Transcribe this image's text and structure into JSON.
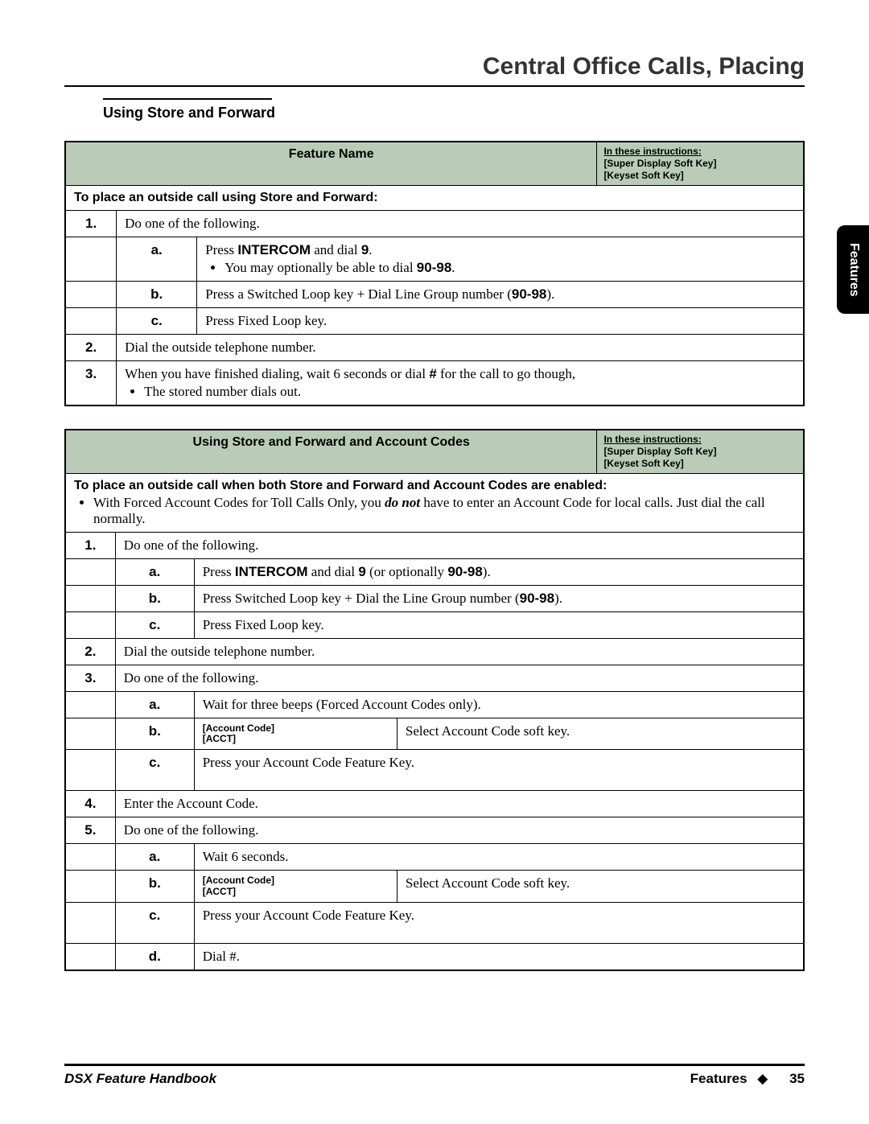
{
  "header": {
    "title": "Central Office Calls, Placing"
  },
  "sideTab": "Features",
  "section": {
    "subtitle": "Using Store and Forward"
  },
  "instructionsBox": {
    "line1": "In these instructions:",
    "line2": "[Super Display Soft Key]",
    "line3": "[Keyset Soft Key]"
  },
  "table1": {
    "title": "Feature Name",
    "sectionHead": "To place an outside call using Store and Forward:",
    "r1_num": "1.",
    "r1_text": "Do one of the following.",
    "r1a_label": "a.",
    "r1a_pre": "Press ",
    "r1a_key": "INTERCOM",
    "r1a_mid": " and dial ",
    "r1a_nine": "9",
    "r1a_dot": ".",
    "r1a_bullet_pre": "You may optionally be able to dial ",
    "r1a_bullet_range": "90-98",
    "r1a_bullet_dot": ".",
    "r1b_label": "b.",
    "r1b_pre": "Press a Switched Loop key + Dial Line Group number (",
    "r1b_range": "90-98",
    "r1b_post": ").",
    "r1c_label": "c.",
    "r1c_text": "Press Fixed Loop key.",
    "r2_num": "2.",
    "r2_text": "Dial the outside telephone number.",
    "r3_num": "3.",
    "r3_pre": "When you have finished dialing, wait 6 seconds or dial ",
    "r3_hash": "#",
    "r3_post": " for the call to go though,",
    "r3_bullet": "The stored number dials out."
  },
  "table2": {
    "title": "Using Store and Forward and Account Codes",
    "sectionHead": "To place an outside call when both Store and Forward and Account Codes are enabled:",
    "section_bullet_pre": "With Forced Account Codes for Toll Calls Only, you ",
    "section_bullet_em": "do not",
    "section_bullet_post": " have to enter an Account Code for local calls. Just dial the call normally.",
    "r1_num": "1.",
    "r1_text": "Do one of the following.",
    "r1a_label": "a.",
    "r1a_pre": "Press ",
    "r1a_key": "INTERCOM",
    "r1a_mid": " and dial ",
    "r1a_nine": "9",
    "r1a_opt": " (or optionally ",
    "r1a_range": "90-98",
    "r1a_end": ").",
    "r1b_label": "b.",
    "r1b_pre": "Press Switched Loop key + Dial the Line Group number (",
    "r1b_range": "90-98",
    "r1b_post": ").",
    "r1c_label": "c.",
    "r1c_text": "Press Fixed Loop key.",
    "r2_num": "2.",
    "r2_text": "Dial the outside telephone number.",
    "r3_num": "3.",
    "r3_text": "Do one of the following.",
    "r3a_label": "a.",
    "r3a_text": "Wait for three beeps (Forced Account Codes only).",
    "r3b_label": "b.",
    "r3b_key1": "[Account Code]",
    "r3b_key2": "[ACCT]",
    "r3b_text": "Select Account Code soft key.",
    "r3c_label": "c.",
    "r3c_text": "Press your Account Code Feature Key.",
    "r4_num": "4.",
    "r4_text": "Enter the Account Code.",
    "r5_num": "5.",
    "r5_text": "Do one of the following.",
    "r5a_label": "a.",
    "r5a_text": "Wait 6 seconds.",
    "r5b_label": "b.",
    "r5b_key1": "[Account Code]",
    "r5b_key2": "[ACCT]",
    "r5b_text": "Select Account Code soft key.",
    "r5c_label": "c.",
    "r5c_text": "Press your Account Code Feature Key.",
    "r5d_label": "d.",
    "r5d_text": "Dial #."
  },
  "footer": {
    "left": "DSX Feature Handbook",
    "rightLabel": "Features",
    "diamond": "◆",
    "pageNum": "35"
  }
}
